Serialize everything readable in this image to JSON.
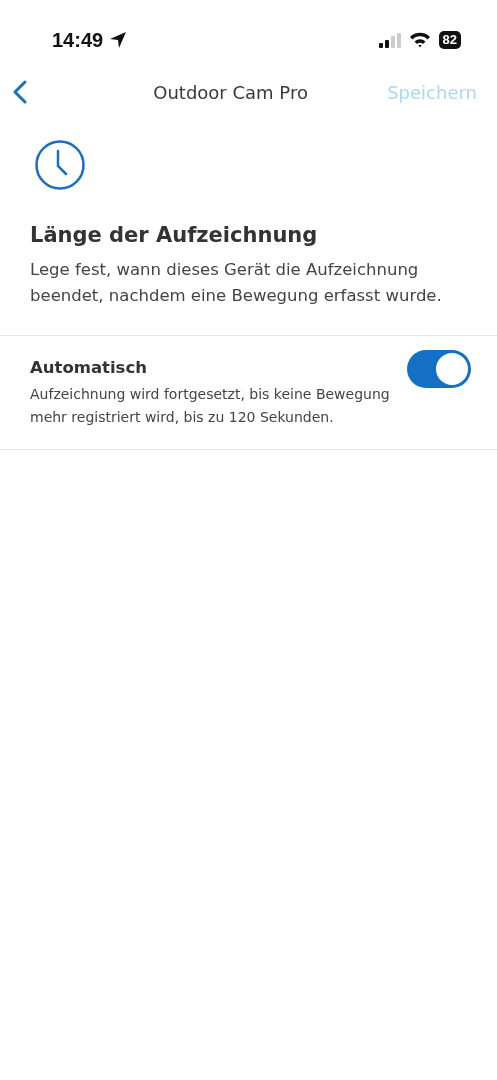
{
  "status_bar": {
    "time": "14:49",
    "battery": "82"
  },
  "nav": {
    "title": "Outdoor Cam Pro",
    "save": {
      "label": "Speichern",
      "disabled": true
    }
  },
  "header": {
    "title": "Länge der Aufzeichnung",
    "description": "Lege fest, wann dieses Gerät die Aufzeichnung beendet, nachdem eine Bewegung erfasst wurde."
  },
  "settings": [
    {
      "label": "Automatisch",
      "description": "Aufzeichnung wird fortgesetzt, bis keine Bewegung mehr registriert wird, bis zu 120 Sekunden.",
      "on": true
    }
  ]
}
